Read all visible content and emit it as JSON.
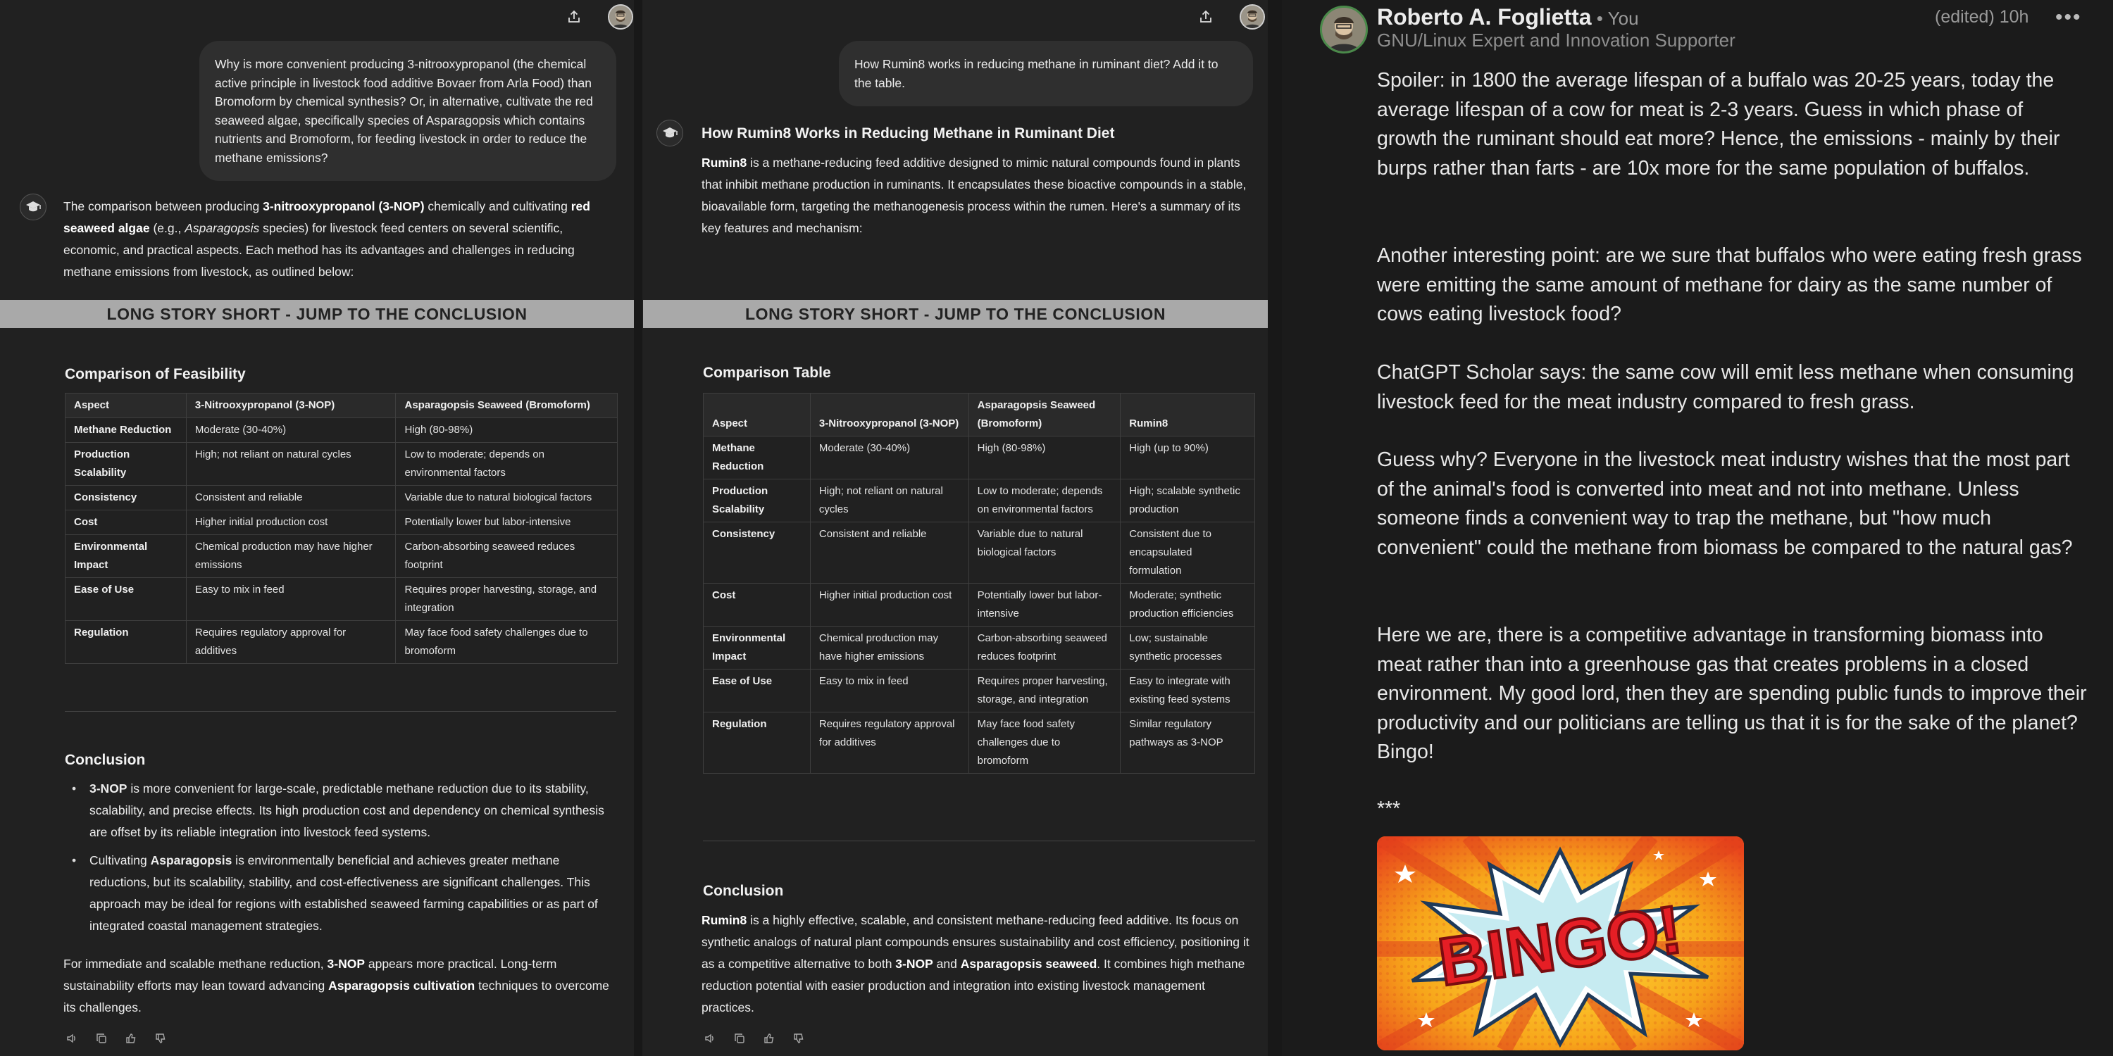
{
  "colors": {
    "bg": "#212121",
    "bubble": "#2f2f2f",
    "banner": "#a9a9a9",
    "table_border": "#3e3e3e"
  },
  "left_chat": {
    "icons": [
      "share-icon",
      "avatar"
    ],
    "user_message": "Why is more convenient producing 3-nitrooxypropanol (the chemical active principle in livestock food additive Bovaer from Arla Food) than Bromoform by chemical synthesis? Or, in alternative, cultivate the red seaweed algae, specifically species of Asparagopsis which contains nutrients and Bromoform, for feeding livestock in order to reduce the methane emissions?",
    "intro": {
      "t1": "The comparison between producing ",
      "b1": "3-nitrooxypropanol (3-NOP)",
      "t2": " chemically and cultivating ",
      "b2": "red seaweed algae",
      "t3": " (e.g., ",
      "i1": "Asparagopsis",
      "t4": " species) for livestock feed centers on several scientific, economic, and practical aspects. Each method has its advantages and challenges in reducing methane emissions from livestock, as outlined below:"
    },
    "banner": "LONG STORY SHORT - JUMP TO THE CONCLUSION",
    "table_title": "Comparison of Feasibility",
    "table": {
      "headers": [
        "Aspect",
        "3-Nitrooxypropanol (3-NOP)",
        "Asparagopsis Seaweed (Bromoform)"
      ],
      "rows": [
        [
          "Methane Reduction",
          "Moderate (30-40%)",
          "High (80-98%)"
        ],
        [
          "Production Scalability",
          "High; not reliant on natural cycles",
          "Low to moderate; depends on environmental factors"
        ],
        [
          "Consistency",
          "Consistent and reliable",
          "Variable due to natural biological factors"
        ],
        [
          "Cost",
          "Higher initial production cost",
          "Potentially lower but labor-intensive"
        ],
        [
          "Environmental Impact",
          "Chemical production may have higher emissions",
          "Carbon-absorbing seaweed reduces footprint"
        ],
        [
          "Ease of Use",
          "Easy to mix in feed",
          "Requires proper harvesting, storage, and integration"
        ],
        [
          "Regulation",
          "Requires regulatory approval for additives",
          "May face food safety challenges due to bromoform"
        ]
      ]
    },
    "conclusion_title": "Conclusion",
    "bullets": [
      {
        "bold": "3-NOP",
        "text": " is more convenient for large-scale, predictable methane reduction due to its stability, scalability, and precise effects. Its high production cost and dependency on chemical synthesis are offset by its reliable integration into livestock feed systems."
      },
      {
        "pre": "Cultivating ",
        "bold": "Asparagopsis",
        "text": " is environmentally beneficial and achieves greater methane reductions, but its scalability, stability, and cost-effectiveness are significant challenges. This approach may be ideal for regions with established seaweed farming capabilities or as part of integrated coastal management strategies."
      }
    ],
    "final": {
      "t1": "For immediate and scalable methane reduction, ",
      "b1": "3-NOP",
      "t2": " appears more practical. Long-term sustainability efforts may lean toward advancing ",
      "b2": "Asparagopsis cultivation",
      "t3": " techniques to overcome its challenges."
    }
  },
  "middle_chat": {
    "user_message": "How Rumin8 works in reducing methane in ruminant diet? Add it to the table.",
    "heading": "How Rumin8 Works in Reducing Methane in Ruminant Diet",
    "intro": {
      "b1": "Rumin8",
      "t1": " is a methane-reducing feed additive designed to mimic natural compounds found in plants that inhibit methane production in ruminants. It encapsulates these bioactive compounds in a stable, bioavailable form, targeting the methanogenesis process within the rumen. Here's a summary of its key features and mechanism:"
    },
    "banner": "LONG STORY SHORT - JUMP TO THE CONCLUSION",
    "table_title": "Comparison Table",
    "table": {
      "headers": [
        "Aspect",
        "3-Nitrooxypropanol (3-NOP)",
        "Asparagopsis Seaweed (Bromoform)",
        "Rumin8"
      ],
      "rows": [
        [
          "Methane Reduction",
          "Moderate (30-40%)",
          "High (80-98%)",
          "High (up to 90%)"
        ],
        [
          "Production Scalability",
          "High; not reliant on natural cycles",
          "Low to moderate; depends on environmental factors",
          "High; scalable synthetic production"
        ],
        [
          "Consistency",
          "Consistent and reliable",
          "Variable due to natural biological factors",
          "Consistent due to encapsulated formulation"
        ],
        [
          "Cost",
          "Higher initial production cost",
          "Potentially lower but labor-intensive",
          "Moderate; synthetic production efficiencies"
        ],
        [
          "Environmental Impact",
          "Chemical production may have higher emissions",
          "Carbon-absorbing seaweed reduces footprint",
          "Low; sustainable synthetic processes"
        ],
        [
          "Ease of Use",
          "Easy to mix in feed",
          "Requires proper harvesting, storage, and integration",
          "Easy to integrate with existing feed systems"
        ],
        [
          "Regulation",
          "Requires regulatory approval for additives",
          "May face food safety challenges due to bromoform",
          "Similar regulatory pathways as 3-NOP"
        ]
      ]
    },
    "conclusion_title": "Conclusion",
    "conclusion": {
      "b1": "Rumin8",
      "t1": " is a highly effective, scalable, and consistent methane-reducing feed additive. Its focus on synthetic analogs of natural plant compounds ensures sustainability and cost efficiency, positioning it as a competitive alternative to both ",
      "b2": "3-NOP",
      "t2": " and ",
      "b3": "Asparagopsis seaweed",
      "t3": ". It combines high methane reduction potential with easier production and integration into existing livestock management practices."
    }
  },
  "post": {
    "author": "Roberto A. Foglietta",
    "you": " • You",
    "subtitle": "GNU/Linux Expert and Innovation Supporter",
    "edited": "(edited) 10h",
    "more": "•••",
    "paragraphs": [
      "Spoiler: in 1800 the average lifespan of a buffalo was 20-25 years, today the average lifespan of a cow for meat is 2-3 years. Guess in which phase of growth the ruminant should eat more? Hence, the emissions - mainly by their burps rather than farts - are 10x more for the same population of buffalos.",
      "Another interesting point: are we sure that buffalos who were eating fresh grass were emitting the same amount of methane for dairy as the same number of cows eating livestock food?",
      "ChatGPT Scholar says: the same cow will emit less methane when consuming livestock feed for the meat industry compared to fresh grass.",
      "Guess why? Everyone in the livestock meat industry wishes that the most part of the animal's food is converted into meat and not into methane. Unless someone finds a convenient way to trap the methane, but \"how much convenient\" could the methane from biomass be compared to the natural gas?",
      "Here we are, there is a competitive advantage in transforming biomass into meat rather than into a greenhouse gas that creates problems in a closed environment. My good lord, then they are spending public funds to improve their productivity and our politicians are telling us that it is for the sake of the planet? Bingo!"
    ],
    "separator": "***",
    "image_text": "BINGO!"
  }
}
